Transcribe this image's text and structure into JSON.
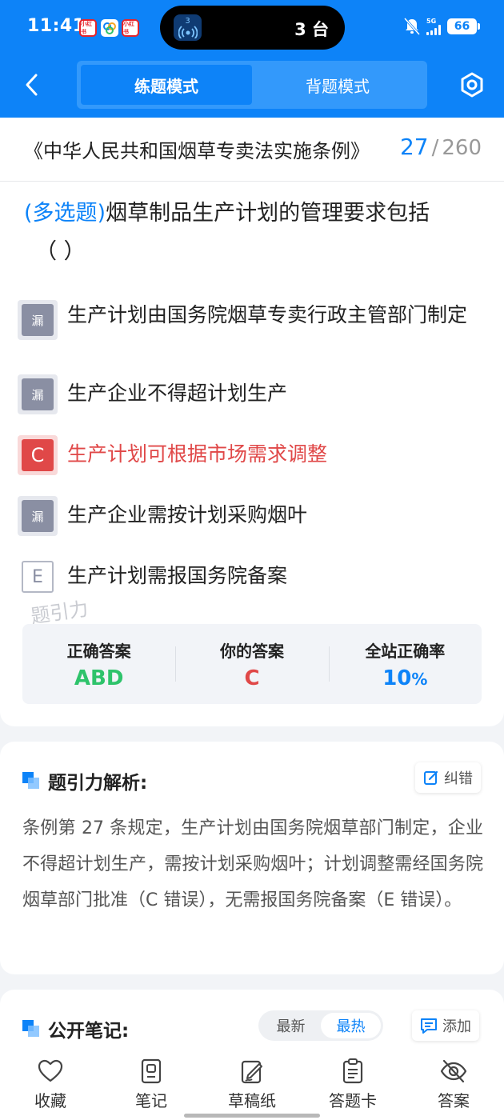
{
  "status_bar": {
    "time": "11:41",
    "app_badges": [
      "小红书",
      "",
      "小红书"
    ],
    "island_icon_number": "3",
    "island_text": "3 台",
    "network": "5G",
    "battery": "66"
  },
  "header": {
    "tabs": [
      {
        "label": "练题模式",
        "active": true
      },
      {
        "label": "背题模式",
        "active": false
      }
    ]
  },
  "title_row": {
    "doc_title": "《中华人民共和国烟草专卖法实施条例》",
    "current": "27",
    "separator": "/",
    "total": "260"
  },
  "question": {
    "type": "(多选题)",
    "text": "烟草制品生产计划的管理要求包括",
    "blank": "（ ）"
  },
  "options": [
    {
      "badge": "漏",
      "state": "miss",
      "text": "生产计划由国务院烟草专卖行政主管部门制定"
    },
    {
      "badge": "漏",
      "state": "miss",
      "text": "生产企业不得超计划生产"
    },
    {
      "badge": "C",
      "state": "wrong",
      "text": "生产计划可根据市场需求调整"
    },
    {
      "badge": "漏",
      "state": "miss",
      "text": "生产企业需按计划采购烟叶"
    },
    {
      "badge": "E",
      "state": "plain",
      "text": "生产计划需报国务院备案"
    }
  ],
  "watermark": "题引力",
  "answers": {
    "correct_label": "正确答案",
    "correct_value": "ABD",
    "yours_label": "你的答案",
    "yours_value": "C",
    "rate_label": "全站正确率",
    "rate_value": "10",
    "rate_unit": "%"
  },
  "analysis": {
    "title": "题引力解析:",
    "report_button": "纠错",
    "text": "条例第 27 条规定，生产计划由国务院烟草部门制定，企业不得超计划生产，需按计划采购烟叶；计划调整需经国务院烟草部门批准（C 错误），无需报国务院备案（E 错误）。"
  },
  "notes": {
    "title": "公开笔记:",
    "sort_options": [
      {
        "label": "最新",
        "active": false
      },
      {
        "label": "最热",
        "active": true
      }
    ],
    "add_button": "添加"
  },
  "toolbar": {
    "items": [
      {
        "label": "收藏",
        "icon": "heart-icon"
      },
      {
        "label": "笔记",
        "icon": "notebook-icon"
      },
      {
        "label": "草稿纸",
        "icon": "draft-paper-icon"
      },
      {
        "label": "答题卡",
        "icon": "answer-sheet-icon"
      },
      {
        "label": "答案",
        "icon": "eye-off-icon"
      }
    ]
  },
  "colors": {
    "brand": "#0d83f8",
    "correct": "#2ec36b",
    "wrong": "#e04848",
    "missed": "#8a8fa3"
  }
}
